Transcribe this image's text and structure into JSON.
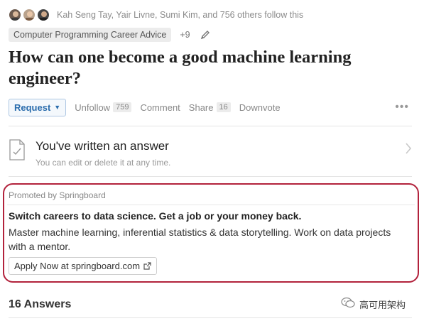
{
  "followers": {
    "text": "Kah Seng Tay, Yair Livne, Sumi Kim, and 756 others follow this",
    "avatar_icons": [
      "person-avatar",
      "person-avatar",
      "person-avatar"
    ]
  },
  "topics": {
    "primary": "Computer Programming Career Advice",
    "more": "+9",
    "edit_icon": "pencil-icon"
  },
  "question": {
    "title": "How can one become a good machine learning engineer?"
  },
  "actions": {
    "request_label": "Request",
    "unfollow_label": "Unfollow",
    "unfollow_count": "759",
    "comment_label": "Comment",
    "share_label": "Share",
    "share_count": "16",
    "downvote_label": "Downvote",
    "more_icon": "ellipsis-icon"
  },
  "your_answer": {
    "title": "You've written an answer",
    "subtitle": "You can edit or delete it at any time."
  },
  "promo": {
    "label": "Promoted by Springboard",
    "headline": "Switch careers to data science. Get a job or your money back.",
    "body": "Master machine learning, inferential statistics & data storytelling. Work on data projects with a mentor.",
    "cta": "Apply Now at springboard.com",
    "border_color": "#b2223c"
  },
  "answers": {
    "header": "16 Answers"
  },
  "watermark": {
    "text": "高可用架构"
  }
}
